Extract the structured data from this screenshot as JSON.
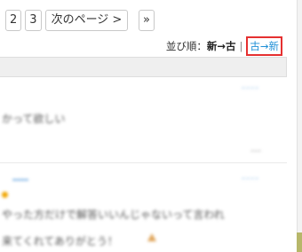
{
  "pagination": {
    "pages": [
      "2",
      "3"
    ],
    "next_label": "次のページ >",
    "last_label": "»"
  },
  "sort": {
    "label": "並び順：",
    "active": "新→古",
    "separator": "|",
    "link": "古→新"
  },
  "posts": [
    {
      "tag": "ｰｰｰｰ",
      "text": "かって欲しい",
      "meta": "ｰｰｰ"
    },
    {
      "name": "ｰｰｰｰ",
      "tag": "ｰｰｰｰ",
      "text_1": "やった方だけで解答いいんじゃないって言われ",
      "text_2": "来てくれてありがとう！"
    }
  ],
  "colors": {
    "accent_link": "#1e8fd6",
    "highlight_border": "#e53030",
    "scroll_thumb": "#b7b76a"
  }
}
